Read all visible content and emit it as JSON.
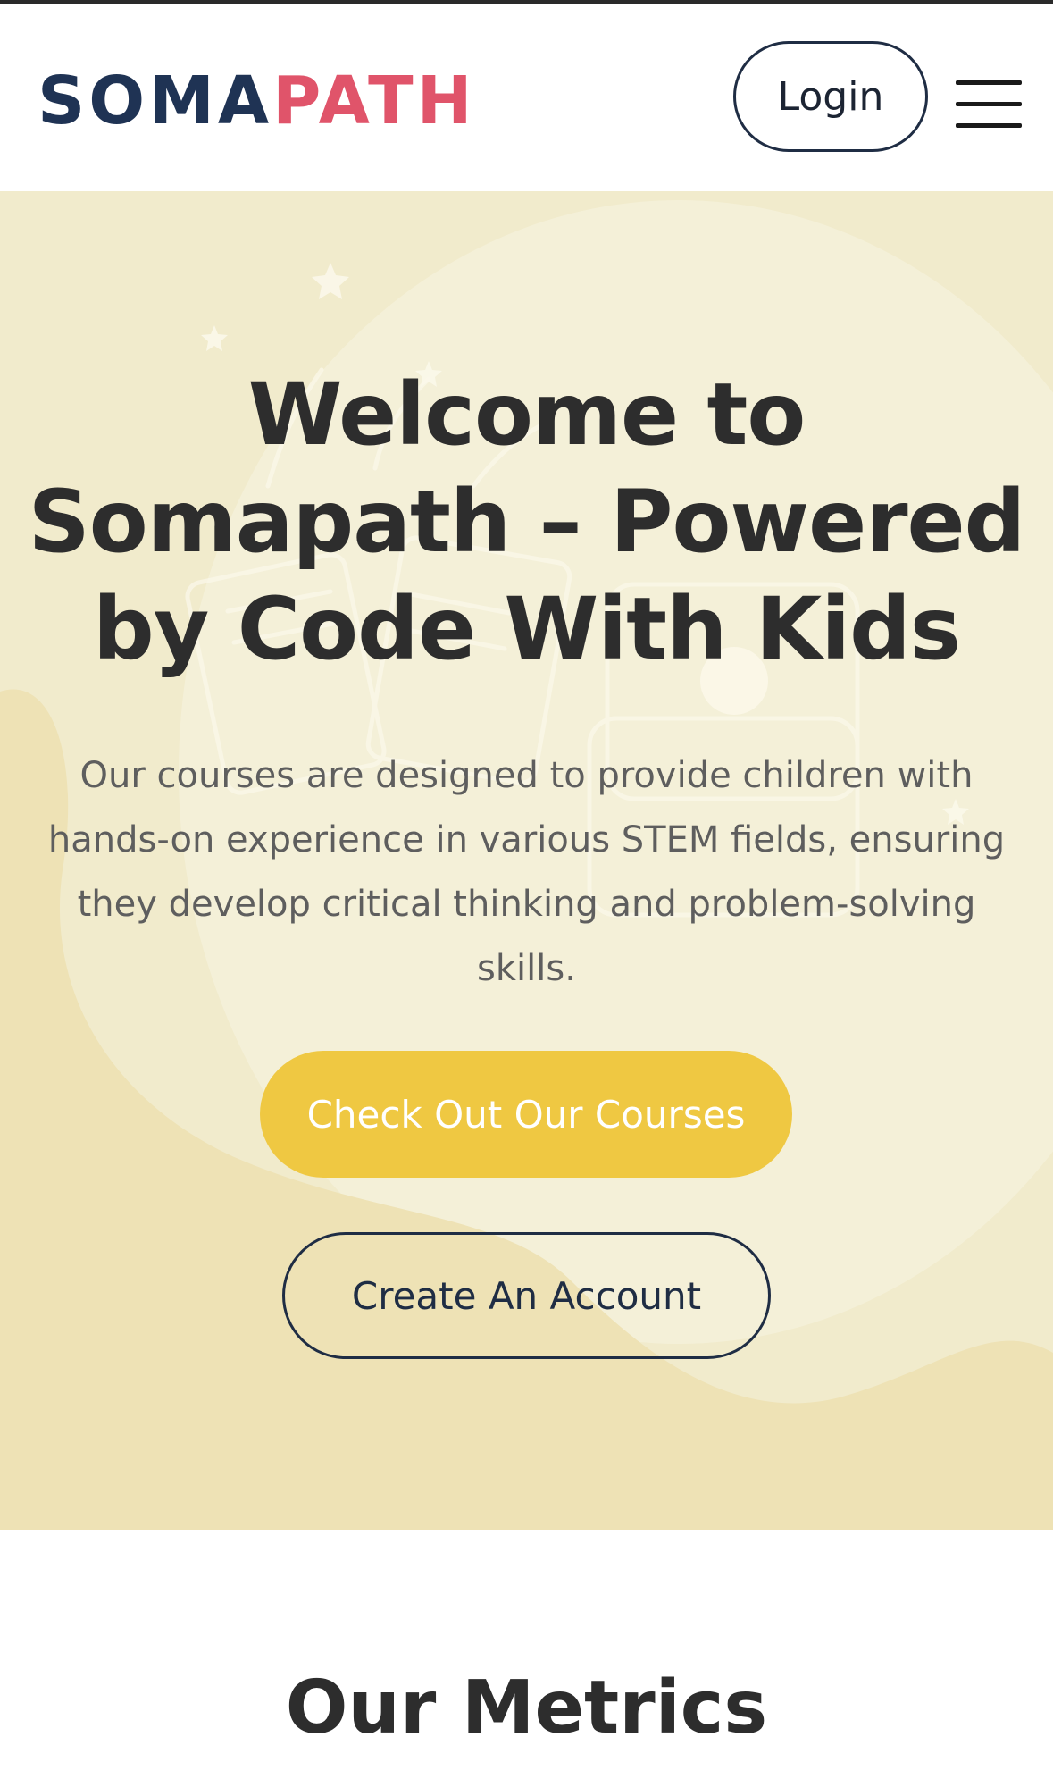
{
  "header": {
    "logo_part1": "SOMA",
    "logo_part2": "PATH",
    "login_label": "Login",
    "menu_icon": "hamburger-menu-icon"
  },
  "hero": {
    "title": "Welcome to Somapath – Powered by Code With Kids",
    "description": "Our courses are designed to provide children with hands-on experience in various STEM fields, ensuring they develop critical thinking and problem-solving skills.",
    "primary_cta": "Check Out Our Courses",
    "secondary_cta": "Create An Account"
  },
  "metrics": {
    "title": "Our Metrics"
  },
  "colors": {
    "brand_navy": "#1f3354",
    "brand_pink": "#e0546a",
    "accent_yellow": "#efc842",
    "hero_background": "#f1ebcc"
  }
}
